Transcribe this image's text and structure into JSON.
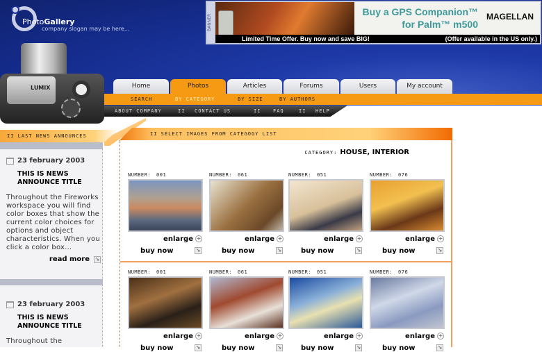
{
  "logo": {
    "brand_light": "Photo",
    "brand_bold": "Gallery",
    "slogan": "company slogan may be here..."
  },
  "banner": {
    "tag": "BANNER",
    "headline1": "Buy a GPS Companion™",
    "headline2": "for Palm™ m500",
    "brand": "MAGELLAN",
    "offer": "Limited Time Offer.  Buy now and save BIG!",
    "note": "(Offer available in the US only.)"
  },
  "camera": {
    "brand": "LUMIX"
  },
  "nav": {
    "tabs": [
      "Home",
      "Photos",
      "Articles",
      "Forums",
      "Users",
      "My account"
    ],
    "active": "Photos"
  },
  "subnav": {
    "items": [
      "SEARCH",
      "BY CATEGORY",
      "BY SIZE",
      "BY AUTHORS"
    ],
    "active": "BY CATEGORY"
  },
  "infonav": {
    "items": [
      "ABOUT COMPANY",
      "CONTACT US",
      "FAQ",
      "HELP"
    ],
    "separator": "II"
  },
  "sidebar": {
    "title": "II LAST NEWS ANNOUNCES",
    "news": [
      {
        "date": "23 february 2003",
        "title": "THIS IS NEWS ANNOUNCE TITLE",
        "body": "Throughout the Fireworks workspace you will find color boxes that show the current color choices for options and object characteristics. When you click a color box...",
        "read_more": "read more"
      },
      {
        "date": "23 february 2003",
        "title": "THIS IS NEWS ANNOUNCE TITLE",
        "body": "Throughout the"
      }
    ]
  },
  "main": {
    "title": "II SELECT IMAGES FROM CATEGOGY LIST",
    "category_label": "CATEGORY:",
    "category": "HOUSE, INTERIOR",
    "number_label": "NUMBER:",
    "enlarge": "enlarge",
    "buy_now": "buy now",
    "rows": [
      [
        {
          "number": "001"
        },
        {
          "number": "061"
        },
        {
          "number": "051"
        },
        {
          "number": "076"
        }
      ],
      [
        {
          "number": "001"
        },
        {
          "number": "061"
        },
        {
          "number": "051"
        },
        {
          "number": "076"
        }
      ]
    ]
  },
  "colors": {
    "accent": "#f59a12",
    "header_blue": "#1e3aa8"
  }
}
